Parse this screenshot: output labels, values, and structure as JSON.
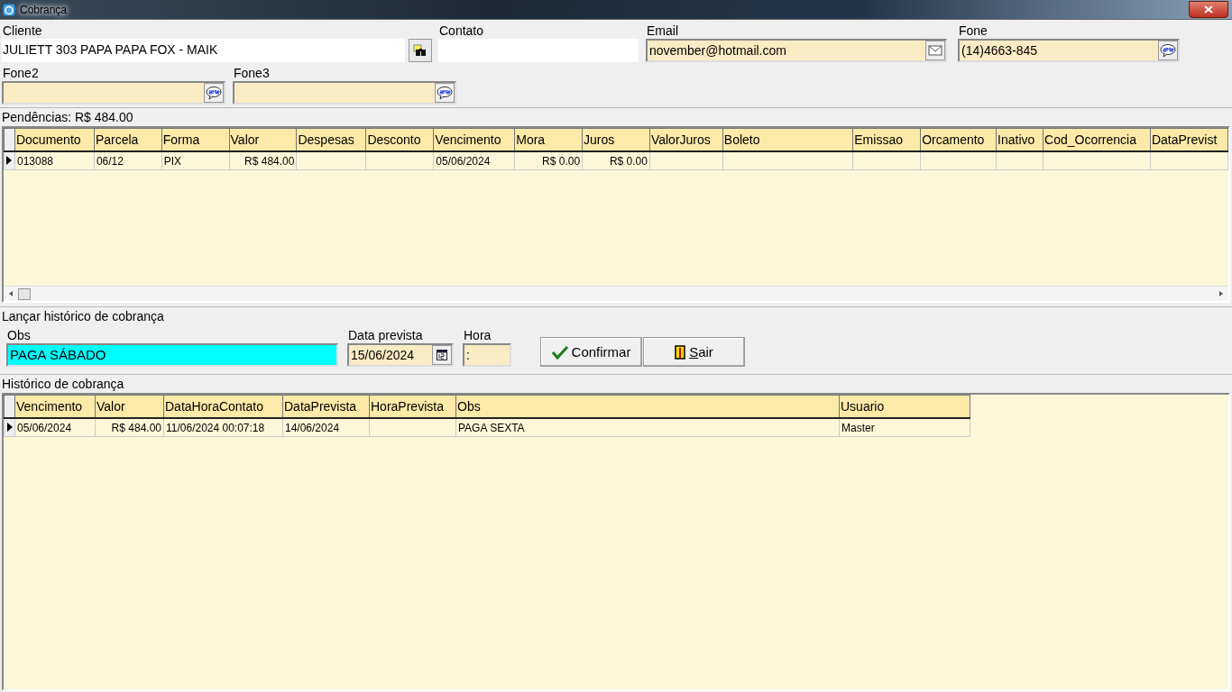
{
  "window": {
    "title": "Cobrança"
  },
  "client": {
    "cliente_label": "Cliente",
    "cliente_value": "JULIETT 303 PAPA PAPA FOX - MAIK",
    "contato_label": "Contato",
    "email_label": "Email",
    "email_value": "november@hotmail.com",
    "fone_label": "Fone",
    "fone_value": "(14)4663-845",
    "fone2_label": "Fone2",
    "fone3_label": "Fone3"
  },
  "pendencias": {
    "title": "Pendências: R$ 484.00",
    "columns": [
      "Documento",
      "Parcela",
      "Forma",
      "Valor",
      "Despesas",
      "Desconto",
      "Vencimento",
      "Mora",
      "Juros",
      "ValorJuros",
      "Boleto",
      "Emissao",
      "Orcamento",
      "Inativo",
      "Cod_Ocorrencia",
      "DataPrevist"
    ],
    "rows": [
      {
        "selected": true,
        "cells": [
          "013088",
          "06/12",
          "PIX",
          "R$ 484.00",
          null,
          null,
          "05/06/2024",
          "R$ 0.00",
          "R$ 0.00",
          null,
          null,
          null,
          null,
          null,
          null,
          null
        ]
      }
    ]
  },
  "lancar": {
    "title": "Lançar histórico de cobrança",
    "obs_label": "Obs",
    "obs_value": "PAGA SÁBADO",
    "data_label": "Data prevista",
    "data_value": "15/06/2024",
    "hora_label": "Hora",
    "hora_value": ":",
    "confirm_button": "Confirmar",
    "exit_button_key": "S",
    "exit_button_rest": "air"
  },
  "historico": {
    "title": "Histórico de cobrança",
    "columns": [
      "Vencimento",
      "Valor",
      "DataHoraContato",
      "DataPrevista",
      "HoraPrevista",
      "Obs",
      "Usuario"
    ],
    "rows": [
      {
        "selected": true,
        "cells": [
          "05/06/2024",
          "R$ 484.00",
          "11/06/2024 00:07:18",
          "14/06/2024",
          null,
          "PAGA SEXTA",
          "Master"
        ]
      }
    ]
  }
}
